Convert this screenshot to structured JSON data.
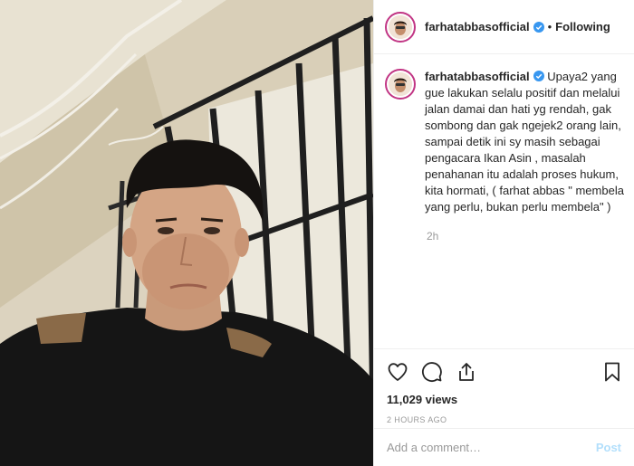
{
  "header": {
    "username": "farhatabbasofficial",
    "separator": "•",
    "follow_label": "Following"
  },
  "caption": {
    "username": "farhatabbasofficial",
    "lines": [
      "Upaya2 yang",
      "gue lakukan selalu positif dan melalui",
      "jalan damai dan hati yg rendah, gak",
      "sombong dan gak ngejek2 orang lain,",
      "sampai detik ini sy masih sebagai",
      "pengacara Ikan Asin , masalah",
      "penahanan itu adalah proses hukum,",
      "kita hormati, ( farhat abbas \" membela",
      "yang perlu, bukan perlu membela\" )"
    ],
    "time_ago": "2h"
  },
  "actions": {
    "views": "11,029 views",
    "posted": "2 HOURS AGO"
  },
  "comment_box": {
    "placeholder": "Add a comment…",
    "post_label": "Post"
  },
  "icons": {
    "verified": "verified-badge-icon",
    "like": "heart-icon",
    "comment": "comment-icon",
    "share": "share-icon",
    "save": "bookmark-icon"
  },
  "colors": {
    "verified_blue": "#3897f0",
    "post_disabled": "#b2dffc",
    "muted_text": "#999999"
  }
}
